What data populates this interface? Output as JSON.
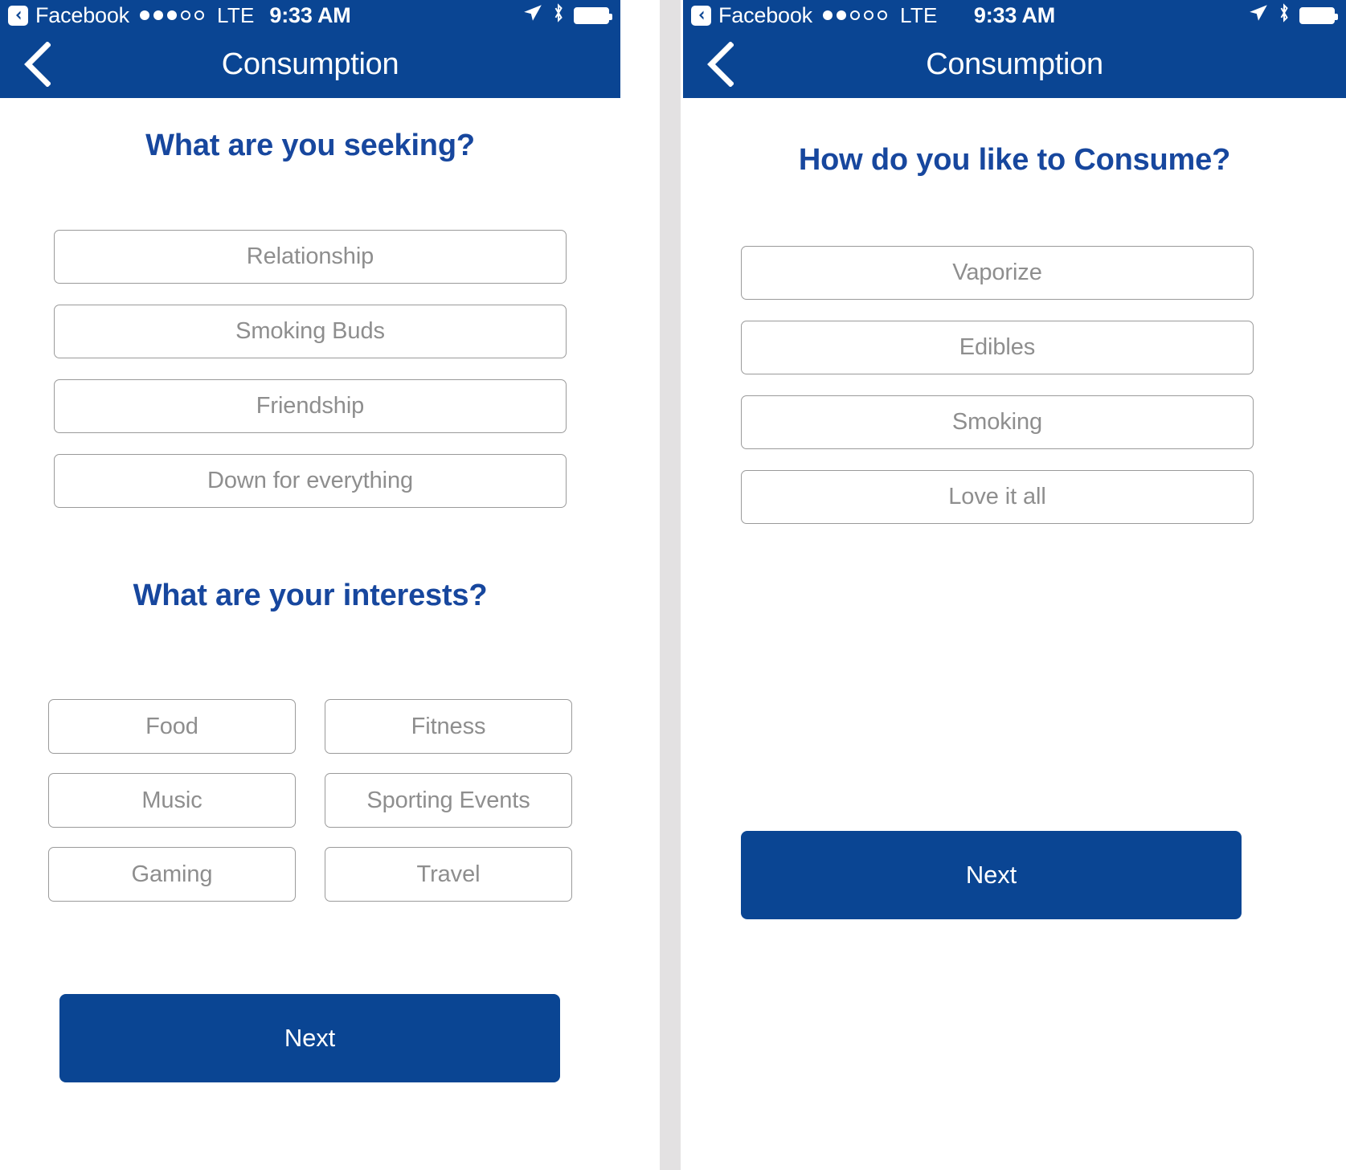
{
  "colors": {
    "header_blue": "#0a4593",
    "heading_blue": "#17479e",
    "button_border": "#9a9a9a",
    "button_text": "#8e8e8e",
    "divider_gray": "#e3e1e2"
  },
  "screens": [
    {
      "id": "seeking-interests-screen",
      "statusbar": {
        "back_app": "Facebook",
        "signal_dots_filled": 3,
        "signal_dots_total": 5,
        "network": "LTE",
        "time": "9:33 AM",
        "location_icon": "location-arrow-icon",
        "bluetooth_icon": "bluetooth-icon",
        "battery_icon": "battery-full-icon"
      },
      "navbar": {
        "back_icon": "back-chevron-icon",
        "title": "Consumption"
      },
      "sections": [
        {
          "title": "What are you seeking?",
          "options": [
            "Relationship",
            "Smoking Buds",
            "Friendship",
            "Down for everything"
          ]
        },
        {
          "title": "What are your interests?",
          "options": [
            "Food",
            "Fitness",
            "Music",
            "Sporting Events",
            "Gaming",
            "Travel"
          ]
        }
      ],
      "next_label": "Next"
    },
    {
      "id": "consumption-method-screen",
      "statusbar": {
        "back_app": "Facebook",
        "signal_dots_filled": 2,
        "signal_dots_total": 5,
        "network": "LTE",
        "time": "9:33 AM",
        "location_icon": "location-arrow-icon",
        "bluetooth_icon": "bluetooth-icon",
        "battery_icon": "battery-full-icon"
      },
      "navbar": {
        "back_icon": "back-chevron-icon",
        "title": "Consumption"
      },
      "sections": [
        {
          "title": "How do you like to Consume?",
          "options": [
            "Vaporize",
            "Edibles",
            "Smoking",
            "Love it all"
          ]
        }
      ],
      "next_label": "Next"
    }
  ]
}
